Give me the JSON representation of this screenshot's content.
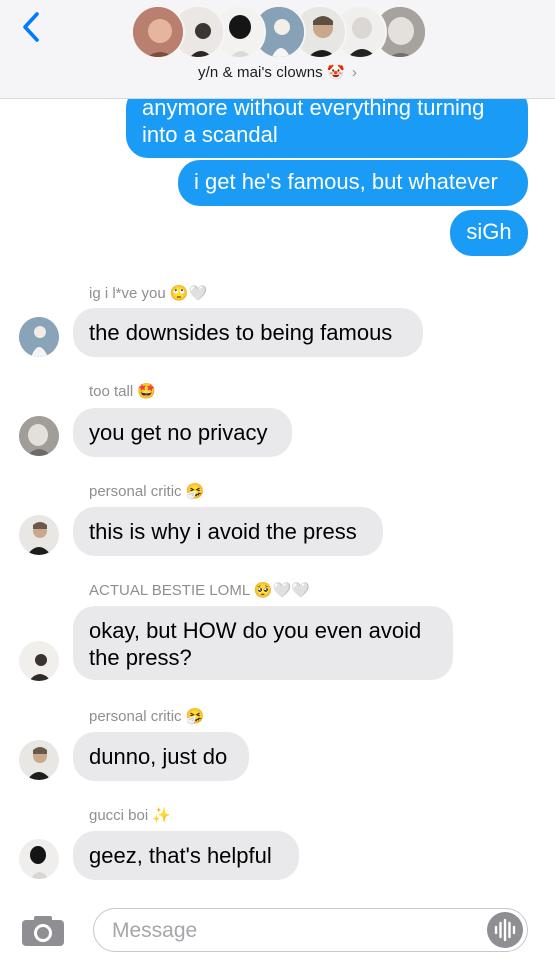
{
  "header": {
    "group_name": "y/n & mai's clowns",
    "group_emoji": "🤡",
    "chevron": "›",
    "back_icon": "chevron-left-icon"
  },
  "messages_out": [
    {
      "text_line1": "anymore without everything turning",
      "text_line2": "into a scandal"
    },
    {
      "text": "i get he's famous, but whatever"
    },
    {
      "text": "siGh"
    }
  ],
  "messages_in": [
    {
      "sender": "ig i l*ve you",
      "sender_emoji": "🙄🤍",
      "text": "the downsides to being famous"
    },
    {
      "sender": "too tall",
      "sender_emoji": "🤩",
      "text": "you get no privacy"
    },
    {
      "sender": "personal critic",
      "sender_emoji": "🤧",
      "text": "this is why i avoid the press"
    },
    {
      "sender": "ACTUAL BESTIE LOML",
      "sender_emoji": "🥺🤍🤍",
      "text": "okay, but HOW do you even avoid the press?"
    },
    {
      "sender": "personal critic",
      "sender_emoji": "🤧",
      "text": "dunno, just do"
    },
    {
      "sender": "gucci boi",
      "sender_emoji": "✨",
      "text": "geez, that's helpful"
    }
  ],
  "composer": {
    "placeholder": "Message",
    "camera_icon": "camera-icon",
    "audio_icon": "audio-waveform-icon"
  },
  "colors": {
    "outgoing_bubble": "#1a9bf5",
    "incoming_bubble": "#e9e9eb",
    "accent": "#007aff"
  }
}
